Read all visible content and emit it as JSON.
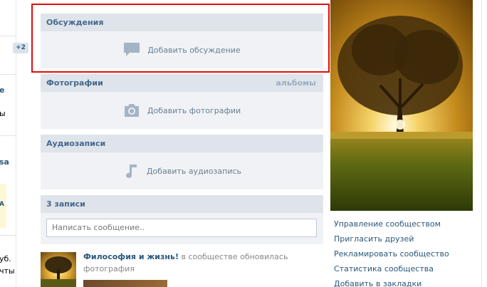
{
  "left": {
    "badge": "+2",
    "fragments": [
      "e",
      "ы",
      "sa",
      "A",
      "уб.",
      "чты"
    ]
  },
  "discussions": {
    "title": "Обсуждения",
    "add_label": "Добавить обсуждение",
    "icon": "speech-bubble-icon"
  },
  "photos": {
    "title": "Фотографии",
    "albums_link": "альбомы",
    "add_label": "Добавить фотографии",
    "icon": "camera-icon"
  },
  "audio": {
    "title": "Аудиозаписи",
    "add_label": "Добавить аудиозапись",
    "icon": "music-note-icon"
  },
  "wall": {
    "title": "3 записи",
    "placeholder": "Написать сообщение.."
  },
  "post": {
    "author": "Философия и жизнь!",
    "action": " в сообществе обновилась",
    "subtitle": "фотография"
  },
  "menu": {
    "items": [
      "Управление сообществом",
      "Пригласить друзей",
      "Рекламировать сообщество",
      "Статистика сообщества",
      "Добавить в закладки"
    ]
  },
  "colors": {
    "highlight": "#e10b0b",
    "link": "#2b587a",
    "header_bg": "#dee4ea",
    "block_bg": "#f0f2f5"
  }
}
